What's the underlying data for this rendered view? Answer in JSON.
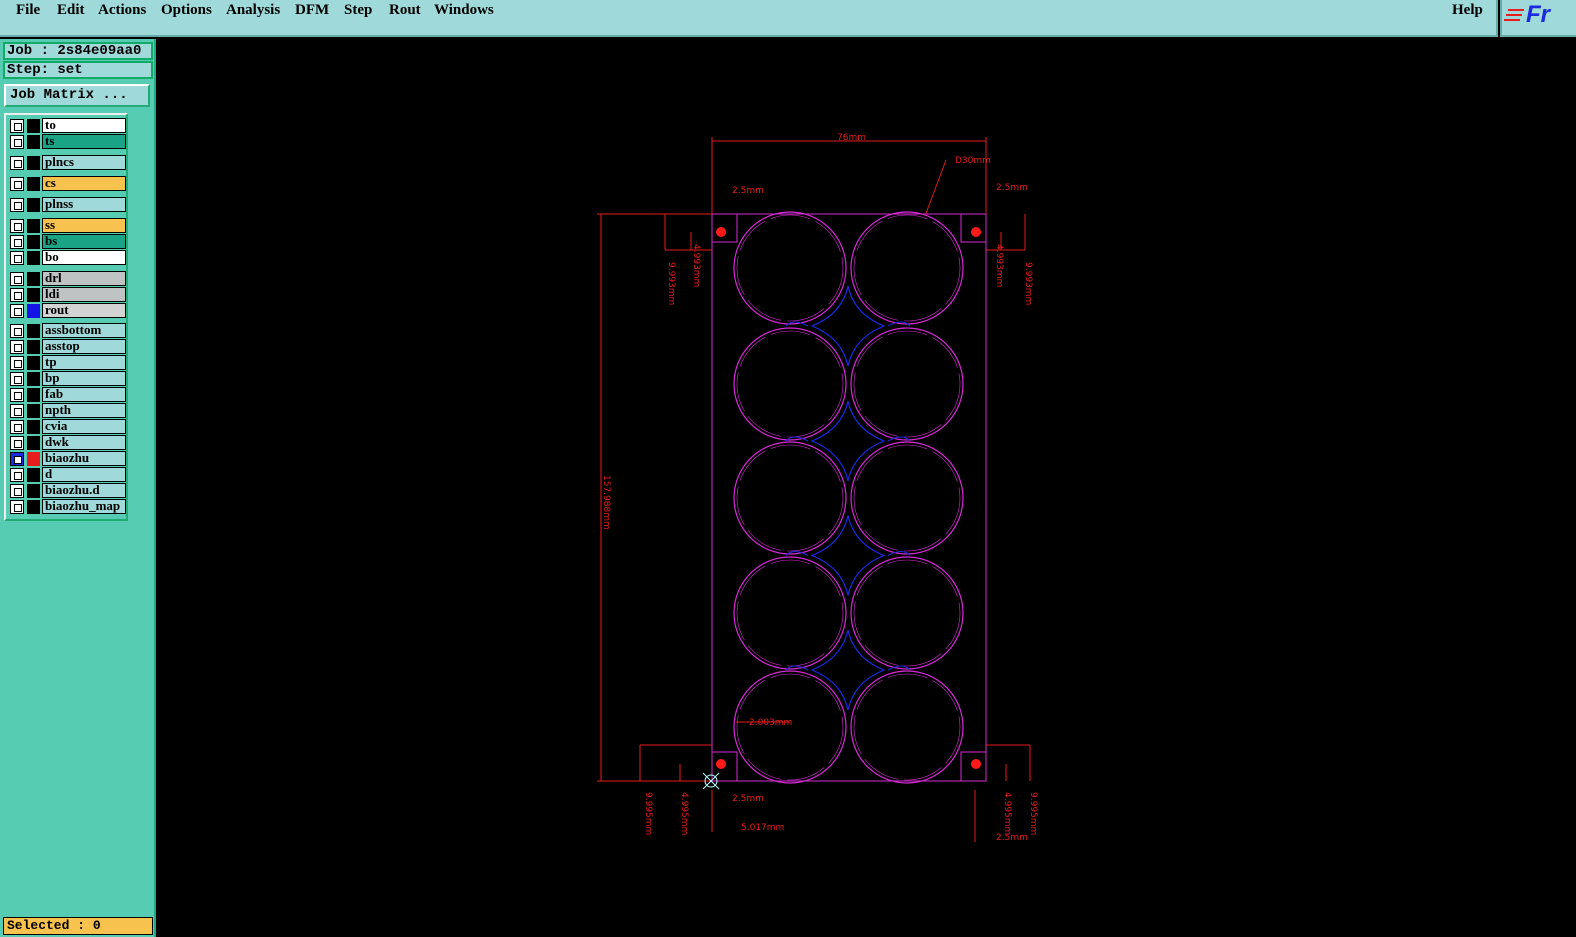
{
  "menu": {
    "file": "File",
    "edit": "Edit",
    "actions": "Actions",
    "options": "Options",
    "analysis": "Analysis",
    "dfm": "DFM",
    "step": "Step",
    "rout": "Rout",
    "windows": "Windows",
    "help": "Help"
  },
  "logo_text": "Fr",
  "job": {
    "job_line": "Job : 2s84e09aa0",
    "step_line": "Step: set",
    "matrix_button": "Job Matrix ..."
  },
  "layers": [
    {
      "name": "to",
      "bg": "#ffffff"
    },
    {
      "name": "ts",
      "bg": "#1aa384"
    },
    {
      "name": "plncs",
      "bg": "#9fd9d9"
    },
    {
      "name": "cs",
      "bg": "#f7c34e"
    },
    {
      "name": "plnss",
      "bg": "#9fd9d9"
    },
    {
      "name": "ss",
      "bg": "#f7c34e"
    },
    {
      "name": "bs",
      "bg": "#1aa384"
    },
    {
      "name": "bo",
      "bg": "#ffffff"
    },
    {
      "name": "drl",
      "bg": "#bfc3c3"
    },
    {
      "name": "ldi",
      "bg": "#bfc3c3"
    },
    {
      "name": "rout",
      "bg": "#d3d3d3",
      "color": "#1414e8"
    },
    {
      "name": "assbottom",
      "bg": "#9fd9d9"
    },
    {
      "name": "asstop",
      "bg": "#9fd9d9"
    },
    {
      "name": "tp",
      "bg": "#9fd9d9"
    },
    {
      "name": "bp",
      "bg": "#9fd9d9"
    },
    {
      "name": "fab",
      "bg": "#9fd9d9"
    },
    {
      "name": "npth",
      "bg": "#9fd9d9"
    },
    {
      "name": "cvia",
      "bg": "#9fd9d9"
    },
    {
      "name": "dwk",
      "bg": "#9fd9d9"
    },
    {
      "name": "biaozhu",
      "bg": "#9fd9d9",
      "color": "#e81c1c",
      "active": true
    },
    {
      "name": "d",
      "bg": "#9fd9d9"
    },
    {
      "name": "biaozhu.d",
      "bg": "#9fd9d9"
    },
    {
      "name": "biaozhu_map",
      "bg": "#9fd9d9"
    }
  ],
  "status": "Selected : 0",
  "dimensions": {
    "width": "76mm",
    "diameter": "D30mm",
    "edge_left": "2.5mm",
    "edge_right": "2.5mm",
    "v_left_inner": "4.993mm",
    "v_left_outer": "9.993mm",
    "v_right_inner": "4.993mm",
    "v_right_outer": "9.993mm",
    "height": "157.988mm",
    "gap": "2.003mm",
    "b_left_outer": "9.995mm",
    "b_left_inner": "4.995mm",
    "b_edge": "2.5mm",
    "b_offset": "5.017mm",
    "b_right_inner": "4.995mm",
    "b_right_outer": "9.995mm",
    "b_edge_right": "2.5mm"
  },
  "colors": {
    "outline": "#d62ad6",
    "rout": "#1a2ae0",
    "dimension": "#e81c1c",
    "panel": "#56cdb2",
    "menu": "#9fd9d9"
  }
}
